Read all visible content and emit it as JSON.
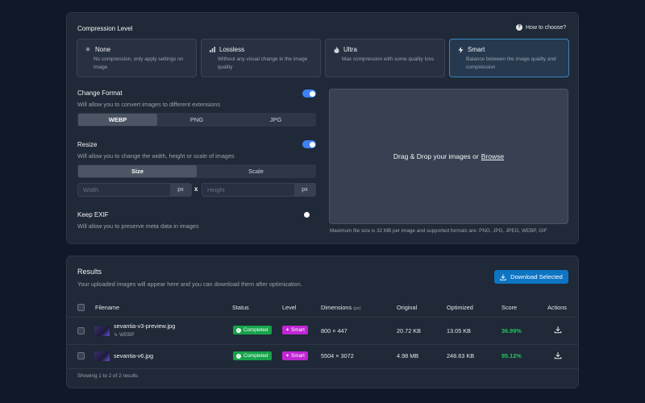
{
  "compression": {
    "title": "Compression Level",
    "help_link": "How to choose?",
    "levels": [
      {
        "name": "None",
        "desc": "No compression, only apply settings on image",
        "icon": "asterisk-icon"
      },
      {
        "name": "Lossless",
        "desc": "Without any visual change in the image quality",
        "icon": "bars-icon"
      },
      {
        "name": "Ultra",
        "desc": "Max compression with some quality loss",
        "icon": "flame-icon"
      },
      {
        "name": "Smart",
        "desc": "Balance between the image quality and compression",
        "icon": "bolt-icon",
        "selected": true
      }
    ]
  },
  "format": {
    "title": "Change Format",
    "desc": "Will allow you to convert images to different extensions",
    "enabled": true,
    "options": [
      "WEBP",
      "PNG",
      "JPG"
    ],
    "selected": "WEBP"
  },
  "resize": {
    "title": "Resize",
    "desc": "Will allow you to change the width, height or scale of images",
    "enabled": true,
    "modes": [
      "Size",
      "Scale"
    ],
    "selected": "Size",
    "width_placeholder": "Width",
    "height_placeholder": "Height",
    "unit": "px",
    "separator": "x"
  },
  "exif": {
    "title": "Keep EXIF",
    "desc": "Will allow you to preserve meta data in images",
    "enabled": false
  },
  "dropzone": {
    "text": "Drag & Drop your images or",
    "browse": "Browse",
    "note": "Maximum file size is 32 MB per image and supported formats are: PNG, JPG, JPEG, WEBP, GIF"
  },
  "results": {
    "title": "Results",
    "desc": "Your uploaded images will appear here and you can download them after optimization.",
    "download_button": "Download Selected",
    "columns": [
      "Filename",
      "Status",
      "Level",
      "Dimensions",
      "Original",
      "Optimized",
      "Score",
      "Actions"
    ],
    "dimensions_unit": "(px)",
    "rows": [
      {
        "filename": "sevantia-v3-preview.jpg",
        "converted": "WEBP",
        "status": "Completed",
        "level": "Smart",
        "dimensions": "800 × 447",
        "original": "20.72 KB",
        "optimized": "13.05 KB",
        "score": "36.99%"
      },
      {
        "filename": "sevantia-v6.jpg",
        "status": "Completed",
        "level": "Smart",
        "dimensions": "5504 × 3072",
        "original": "4.98 MB",
        "optimized": "248.63 KB",
        "score": "95.12%"
      }
    ],
    "footer": "Showing 1 to 2 of 2 results"
  },
  "colors": {
    "accent": "#3b82f6",
    "success": "#16a34a",
    "smart_badge": "#c026d3",
    "score": "#22c55e"
  }
}
